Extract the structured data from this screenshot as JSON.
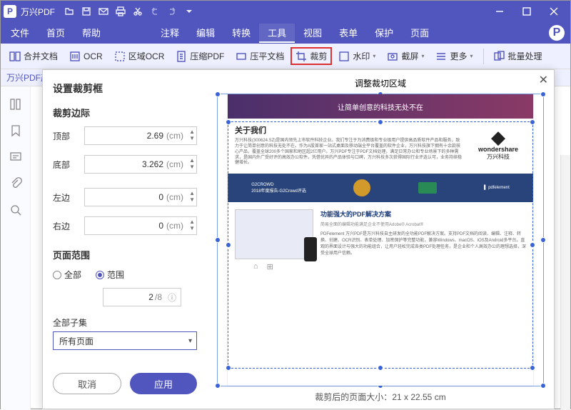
{
  "app": {
    "title": "万兴PDF"
  },
  "menubar": {
    "items": [
      "文件",
      "首页",
      "帮助",
      "注释",
      "编辑",
      "转换",
      "工具",
      "视图",
      "表单",
      "保护",
      "页面"
    ],
    "active_index": 6
  },
  "ribbon": {
    "merge": "合并文档",
    "ocr": "OCR",
    "area_ocr": "区域OCR",
    "compress": "压缩PDF",
    "flatten": "压平文档",
    "crop": "裁剪",
    "watermark": "水印",
    "screenshot": "截屏",
    "more": "更多",
    "batch": "批量处理"
  },
  "doc_tab": "万兴PDF产",
  "dialog": {
    "title": "设置裁剪框",
    "margins_label": "裁剪边际",
    "top_label": "顶部",
    "bottom_label": "底部",
    "left_label": "左边",
    "right_label": "右边",
    "top_value": "2.69",
    "bottom_value": "3.262",
    "left_value": "0",
    "right_value": "0",
    "unit": "(cm)",
    "range_label": "页面范围",
    "radio_all": "全部",
    "radio_range": "范围",
    "page_current": "2",
    "page_total": "/8",
    "subset_label": "全部子集",
    "subset_value": "所有页面",
    "cancel": "取消",
    "apply": "应用",
    "preview_title": "调整裁切区域",
    "result_prefix": "裁剪后的页面大小：",
    "result_size": "21 x 22.55 cm"
  },
  "preview_doc": {
    "tagline": "让简单创意的科技无处不在",
    "about_heading": "关于我们",
    "about_body": "万兴科技(300624.SZ)是国内领先上市软件科技企业。我们专注于为消费级和专业级用户提供高品质软件产品和服务，致力于让简单创意的科技无处不在。作为A股首家一站式桌面及移动端全平台覆盖的软件企业，万兴科技旗下拥有十余款核心产品，覆盖全球200多个国家和地区超2亿用户。万兴PDF专注于PDF文档处理，满足日常办公和专业场景下的多种需求，是国内外广受好评的高效办公软件。凭借优异的产品体验与口碑，万兴科技多次获得国际行业评选认可，业务持续稳健增长。",
    "brand_en": "wondershare",
    "brand_cn": "万兴科技",
    "band2_a": "G2CROWD",
    "band2_b": "2018年度报告-G2Crowd评选",
    "band2_c": "pdfelement",
    "solution_heading": "功能强大的PDF解决方案",
    "solution_sub": "简易全面的编辑功能满足企业不使用Adobe® Acrobat®",
    "solution_body": "PDFelement 万兴PDF是万兴科技自主研发的全功能PDF解决方案。支持PDF文档的阅读、编辑、注释、转换、创建、OCR识别、表单处理、加密保护等完整功能，兼容Windows、macOS、iOS及Android多平台。直观的界面设计与强大的功能组合，让用户轻松完成各类PDF处理任务，是企业和个人高效办公的理想选择，深受全球用户信赖。"
  }
}
